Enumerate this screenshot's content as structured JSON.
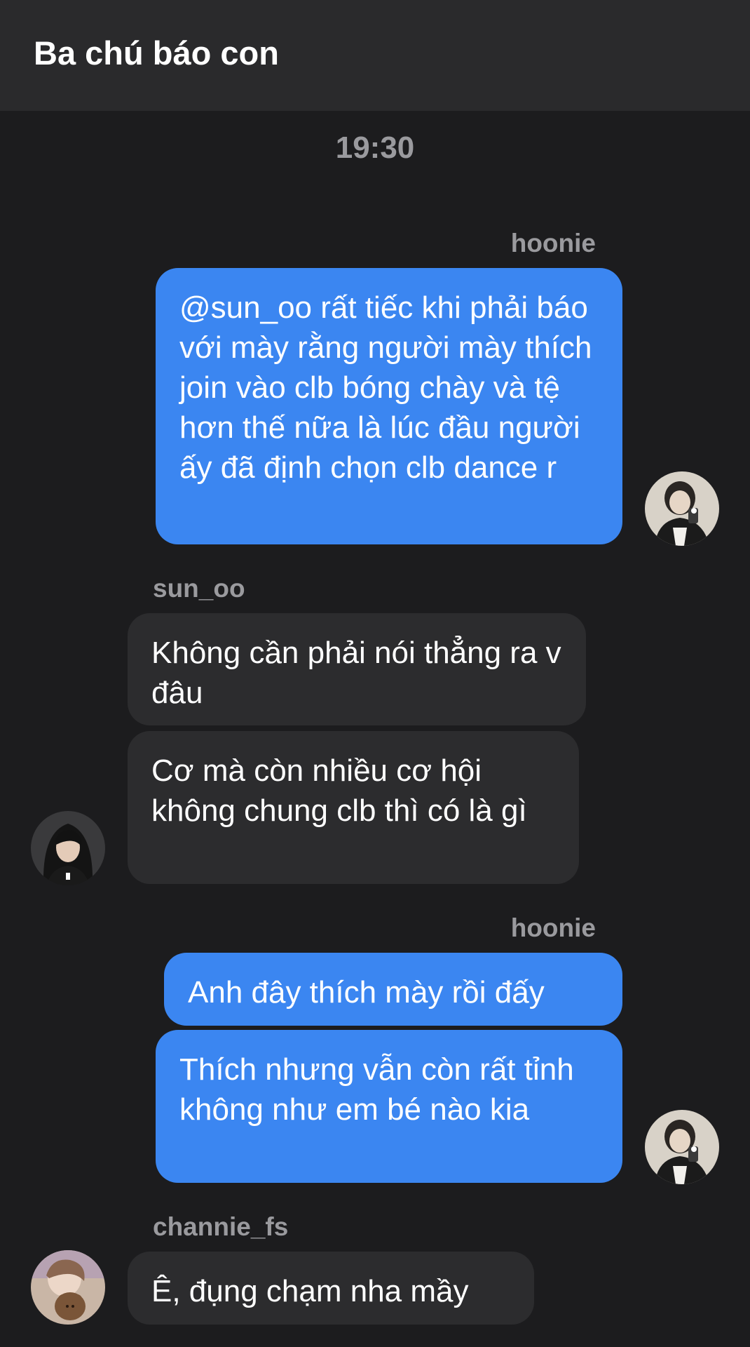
{
  "header": {
    "title": "Ba chú báo con"
  },
  "chat": {
    "timestamp": "19:30",
    "messages": [
      {
        "sender": "hoonie",
        "texts": [
          "@sun_oo rất tiếc khi phải báo với mày rằng người mày thích join vào clb bóng chày và tệ hơn thế nữa là lúc đầu người ấy đã định chọn clb dance r"
        ]
      },
      {
        "sender": "sun_oo",
        "texts": [
          "Không cần phải nói thẳng ra v đâu",
          "Cơ mà còn nhiều cơ hội không chung clb thì có là gì"
        ]
      },
      {
        "sender": "hoonie",
        "texts": [
          "Anh đây thích mày rồi đấy",
          "Thích nhưng vẫn còn rất tỉnh không như em bé nào kia"
        ]
      },
      {
        "sender": "channie_fs",
        "texts": [
          "Ê, đụng chạm nha mầy"
        ]
      }
    ]
  },
  "colors": {
    "header_bg": "#2a2a2c",
    "chat_bg": "#1c1c1e",
    "outgoing_bubble": "#3b86f1",
    "incoming_bubble": "#2c2c2e",
    "muted_text": "#9a9a9e"
  },
  "icons": {
    "avatar_hoonie": "avatar-hoonie",
    "avatar_sun_oo": "avatar-sun-oo",
    "avatar_channie": "avatar-channie-fs"
  }
}
